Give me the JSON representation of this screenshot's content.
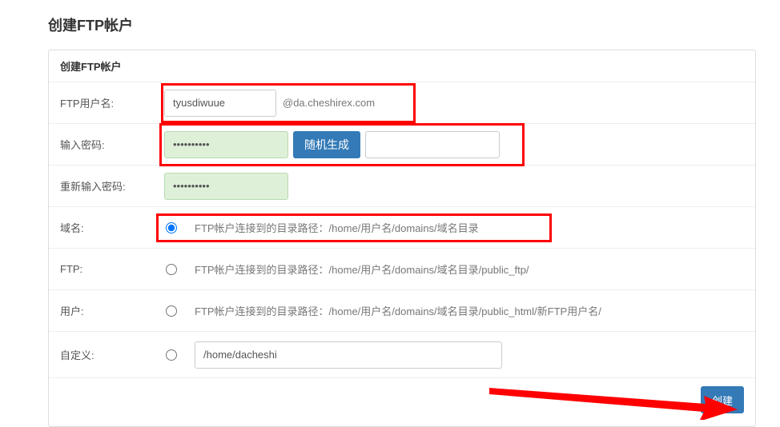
{
  "page": {
    "title": "创建FTP帐户"
  },
  "panel": {
    "header": "创建FTP帐户"
  },
  "form": {
    "username": {
      "label": "FTP用户名:",
      "value": "tyusdiwuue",
      "suffix": "@da.cheshirex.com"
    },
    "password": {
      "label": "输入密码:",
      "value": "••••••••••",
      "random_button": "随机生成",
      "plain_value": ""
    },
    "password2": {
      "label": "重新输入密码:",
      "value": "••••••••••"
    },
    "options": [
      {
        "key": "domain",
        "label": "域名:",
        "checked": true,
        "desc": "FTP帐户连接到的目录路径：/home/用户名/domains/域名目录"
      },
      {
        "key": "ftp",
        "label": "FTP:",
        "checked": false,
        "desc": "FTP帐户连接到的目录路径：/home/用户名/domains/域名目录/public_ftp/"
      },
      {
        "key": "user",
        "label": "用户:",
        "checked": false,
        "desc": "FTP帐户连接到的目录路径：/home/用户名/domains/域名目录/public_html/新FTP用户名/"
      }
    ],
    "custom": {
      "label": "自定义:",
      "checked": false,
      "value": "/home/dacheshi"
    }
  },
  "footer": {
    "submit": "创建"
  }
}
